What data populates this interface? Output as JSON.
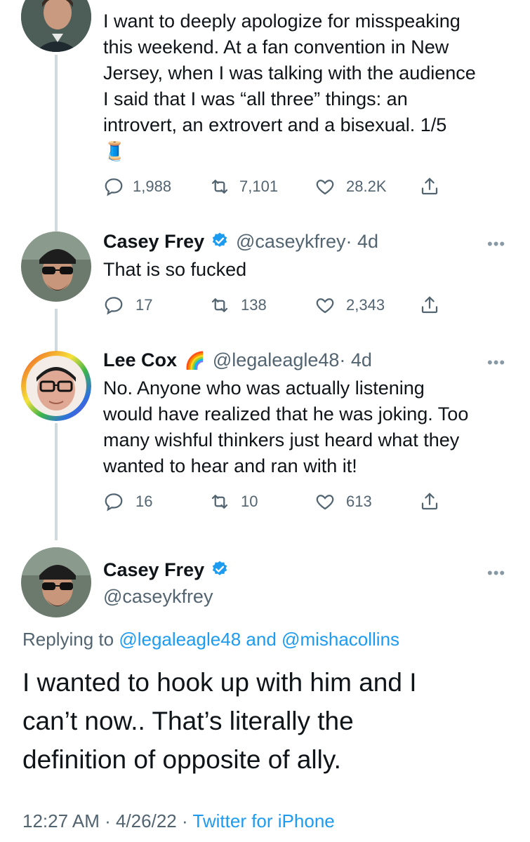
{
  "tweets": [
    {
      "text_lines": [
        "I want to deeply apologize for misspeaking",
        "this weekend. At a fan convention in New",
        "Jersey, when I was talking with the audience",
        "I said that I was “all three” things: an",
        "introvert, an extrovert and a bisexual.  1/5"
      ],
      "emoji": "🧵",
      "replies": "1,988",
      "retweets": "7,101",
      "likes": "28.2K"
    },
    {
      "name": "Casey Frey",
      "handle": "@caseykfrey",
      "time": "· 4d",
      "text_lines": [
        "That is so fucked"
      ],
      "replies": "17",
      "retweets": "138",
      "likes": "2,343"
    },
    {
      "name": "Lee Cox",
      "name_emoji": "🌈",
      "handle": "@legaleagle48",
      "time": "· 4d",
      "text_lines": [
        "No. Anyone who was actually listening",
        "would have realized that he was joking. Too",
        "many wishful thinkers just heard what they",
        "wanted to hear and ran with it!"
      ],
      "replies": "16",
      "retweets": "10",
      "likes": "613"
    }
  ],
  "main": {
    "name": "Casey Frey",
    "handle": "@caseykfrey",
    "replying_prefix": "Replying to",
    "replying_user1": "@legaleagle48",
    "replying_and": "and",
    "replying_user2": "@mishacollins",
    "text_lines": [
      "I wanted to hook up with him and I",
      "can’t now.. That’s literally the",
      "definition of opposite of ally."
    ],
    "time": "12:27 AM",
    "date": "4/26/22",
    "sep": "·",
    "source": "Twitter for iPhone"
  },
  "more_label": "•••",
  "colors": {
    "link": "#1d9bf0",
    "secondary": "#536471",
    "thread_line": "#cfd9de"
  }
}
